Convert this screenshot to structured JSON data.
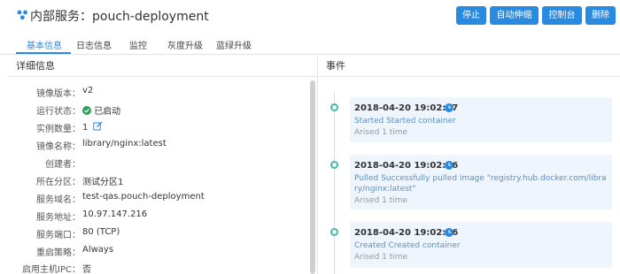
{
  "header": {
    "title": "内部服务：pouch-deployment",
    "buttons": {
      "stop": "停止",
      "autoscale": "自动伸缩",
      "console": "控制台",
      "delete": "删除"
    }
  },
  "tabs": [
    "基本信息",
    "日志信息",
    "监控",
    "灰度升级",
    "蓝绿升级"
  ],
  "details": {
    "title": "详细信息",
    "rows": [
      {
        "label": "镜像版本：",
        "value": "v2"
      },
      {
        "label": "运行状态：",
        "value": "已启动"
      },
      {
        "label": "实例数量：",
        "value": "1"
      },
      {
        "label": "镜像名称：",
        "value": "library/nginx:latest"
      },
      {
        "label": "创建者：",
        "value": ""
      },
      {
        "label": "所在分区：",
        "value": "测试分区1"
      },
      {
        "label": "服务域名：",
        "value": "test-qas.pouch-deployment"
      },
      {
        "label": "服务地址：",
        "value": "10.97.147.216"
      },
      {
        "label": "服务端口：",
        "value": "80 (TCP)"
      },
      {
        "label": "重启策略：",
        "value": "Always"
      },
      {
        "label": "启用主机IPC：",
        "value": "否"
      }
    ]
  },
  "events": {
    "title": "事件",
    "items": [
      {
        "time": "2018-04-20 19:02:17",
        "message": "Started Started container",
        "count": "Arised 1 time"
      },
      {
        "time": "2018-04-20 19:02:16",
        "message": "Pulled Successfully pulled image \"registry.hub.docker.com/library/nginx:latest\"",
        "count": "Arised 1 time"
      },
      {
        "time": "2018-04-20 19:02:16",
        "message": "Created Created container",
        "count": "Arised 1 time"
      }
    ]
  },
  "colors": {
    "accent": "#2a8ae0",
    "status_running": "#2aa05a",
    "timeline": "#3fb8b0",
    "card_bg": "#eef5fc"
  }
}
